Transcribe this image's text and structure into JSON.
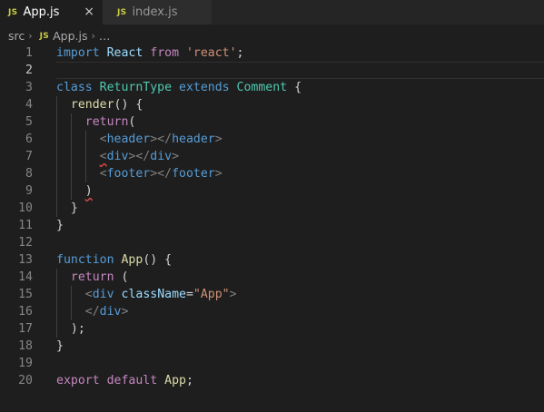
{
  "tabs": [
    {
      "icon": "JS",
      "label": "App.js",
      "active": true,
      "close": "×"
    },
    {
      "icon": "JS",
      "label": "index.js",
      "active": false
    }
  ],
  "breadcrumb": {
    "folder": "src",
    "icon": "JS",
    "file": "App.js",
    "more": "…"
  },
  "colors": {
    "editor_bg": "#1e1e1e",
    "keyword": "#569cd6",
    "control": "#c586c0",
    "function": "#dcdcaa",
    "class": "#4ec9b0",
    "string": "#ce9178"
  },
  "code": [
    {
      "n": "1",
      "tokens": [
        [
          "kw",
          "import"
        ],
        [
          "plain",
          " "
        ],
        [
          "var",
          "React"
        ],
        [
          "plain",
          " "
        ],
        [
          "ctl",
          "from"
        ],
        [
          "plain",
          " "
        ],
        [
          "str",
          "'react'"
        ],
        [
          "plain",
          ";"
        ]
      ]
    },
    {
      "n": "2",
      "current": true,
      "tokens": []
    },
    {
      "n": "3",
      "tokens": [
        [
          "kw",
          "class"
        ],
        [
          "plain",
          " "
        ],
        [
          "cls",
          "ReturnType"
        ],
        [
          "plain",
          " "
        ],
        [
          "kw",
          "extends"
        ],
        [
          "plain",
          " "
        ],
        [
          "cls",
          "Comment"
        ],
        [
          "plain",
          " {"
        ]
      ]
    },
    {
      "n": "4",
      "tokens": [
        [
          "plain",
          "  "
        ],
        [
          "fn",
          "render"
        ],
        [
          "plain",
          "() {"
        ]
      ]
    },
    {
      "n": "5",
      "tokens": [
        [
          "plain",
          "    "
        ],
        [
          "ctl",
          "return"
        ],
        [
          "plain",
          "("
        ]
      ]
    },
    {
      "n": "6",
      "tokens": [
        [
          "plain",
          "      "
        ],
        [
          "punct",
          "<"
        ],
        [
          "tag",
          "header"
        ],
        [
          "punct",
          "></"
        ],
        [
          "tag",
          "header"
        ],
        [
          "punct",
          ">"
        ]
      ]
    },
    {
      "n": "7",
      "tokens": [
        [
          "plain",
          "      "
        ],
        [
          "punct",
          "<",
          "squiggle"
        ],
        [
          "tag",
          "div"
        ],
        [
          "punct",
          "></"
        ],
        [
          "tag",
          "div"
        ],
        [
          "punct",
          ">"
        ]
      ]
    },
    {
      "n": "8",
      "tokens": [
        [
          "plain",
          "      "
        ],
        [
          "punct",
          "<"
        ],
        [
          "tag",
          "footer"
        ],
        [
          "punct",
          "></"
        ],
        [
          "tag",
          "footer"
        ],
        [
          "punct",
          ">"
        ]
      ]
    },
    {
      "n": "9",
      "tokens": [
        [
          "plain",
          "    "
        ],
        [
          "plain",
          ")",
          "squiggle"
        ]
      ]
    },
    {
      "n": "10",
      "tokens": [
        [
          "plain",
          "  }"
        ]
      ]
    },
    {
      "n": "11",
      "tokens": [
        [
          "plain",
          "}"
        ]
      ]
    },
    {
      "n": "12",
      "tokens": []
    },
    {
      "n": "13",
      "tokens": [
        [
          "kw",
          "function"
        ],
        [
          "plain",
          " "
        ],
        [
          "fn",
          "App"
        ],
        [
          "plain",
          "() {"
        ]
      ]
    },
    {
      "n": "14",
      "tokens": [
        [
          "plain",
          "  "
        ],
        [
          "ctl",
          "return"
        ],
        [
          "plain",
          " ("
        ]
      ]
    },
    {
      "n": "15",
      "tokens": [
        [
          "plain",
          "    "
        ],
        [
          "punct",
          "<"
        ],
        [
          "tag",
          "div"
        ],
        [
          "plain",
          " "
        ],
        [
          "attr",
          "className"
        ],
        [
          "plain",
          "="
        ],
        [
          "str",
          "\"App\""
        ],
        [
          "punct",
          ">"
        ]
      ]
    },
    {
      "n": "16",
      "tokens": [
        [
          "plain",
          "    "
        ],
        [
          "punct",
          "</"
        ],
        [
          "tag",
          "div"
        ],
        [
          "punct",
          ">"
        ]
      ]
    },
    {
      "n": "17",
      "tokens": [
        [
          "plain",
          "  );"
        ]
      ]
    },
    {
      "n": "18",
      "tokens": [
        [
          "plain",
          "}"
        ]
      ]
    },
    {
      "n": "19",
      "tokens": []
    },
    {
      "n": "20",
      "tokens": [
        [
          "ctl",
          "export"
        ],
        [
          "plain",
          " "
        ],
        [
          "ctl",
          "default"
        ],
        [
          "plain",
          " "
        ],
        [
          "fn",
          "App"
        ],
        [
          "plain",
          ";"
        ]
      ]
    }
  ]
}
